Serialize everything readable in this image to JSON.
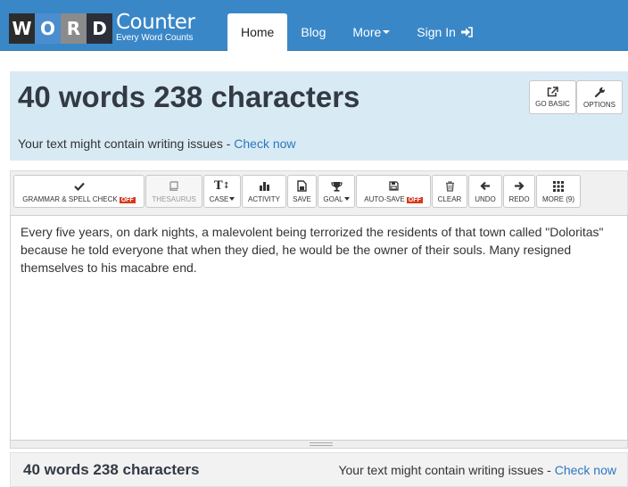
{
  "navbar": {
    "logo_letters": [
      "W",
      "O",
      "R",
      "D"
    ],
    "logo_main": "Counter",
    "logo_sub": "Every Word Counts",
    "items": [
      {
        "label": "Home"
      },
      {
        "label": "Blog"
      },
      {
        "label": "More"
      },
      {
        "label": "Sign In"
      }
    ]
  },
  "stats": {
    "title": "40 words 238 characters",
    "issues_text": "Your text might contain writing issues - ",
    "issues_link": "Check now"
  },
  "top_buttons": {
    "go_basic": "GO BASIC",
    "options": "OPTIONS"
  },
  "toolbar": {
    "grammar": "GRAMMAR & SPELL CHECK",
    "grammar_state": "OFF",
    "thesaurus": "THESAURUS",
    "case": "CASE",
    "activity": "ACTIVITY",
    "save": "SAVE",
    "goal": "GOAL",
    "autosave": "AUTO-SAVE",
    "autosave_state": "OFF",
    "clear": "CLEAR",
    "undo": "UNDO",
    "redo": "REDO",
    "more": "MORE (9)"
  },
  "editor": {
    "text": "Every five years, on dark nights, a malevolent being terrorized the residents of that town called \"Doloritas\" because he told everyone that when they died, he would be the owner of their souls. Many resigned themselves to his macabre end."
  },
  "bottom": {
    "title": "40 words 238 characters",
    "issues_text": "Your text might contain writing issues - ",
    "issues_link": "Check now"
  },
  "colors": {
    "navbar": "#3a87c8",
    "band": "#d8eaf4",
    "link": "#2a77c0",
    "off_badge": "#d9381e"
  }
}
